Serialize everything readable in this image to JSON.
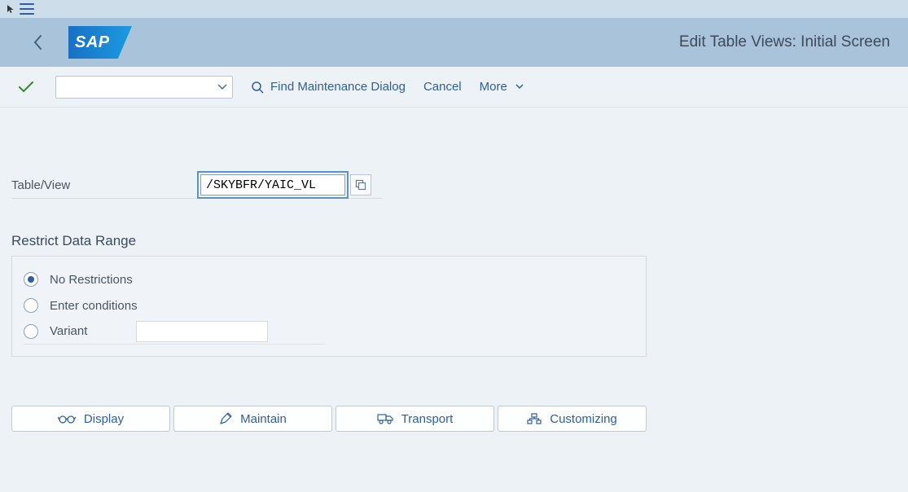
{
  "header": {
    "title": "Edit Table Views: Initial Screen"
  },
  "toolbar": {
    "find_maintenance": "Find Maintenance Dialog",
    "cancel": "Cancel",
    "more": "More"
  },
  "fields": {
    "table_view_label": "Table/View",
    "table_view_value": "/SKYBFR/YAIC_VL"
  },
  "restrict": {
    "title": "Restrict Data Range",
    "options": {
      "no_restrictions": "No Restrictions",
      "enter_conditions": "Enter conditions",
      "variant": "Variant"
    },
    "variant_value": ""
  },
  "buttons": {
    "display": "Display",
    "maintain": "Maintain",
    "transport": "Transport",
    "customizing": "Customizing"
  }
}
